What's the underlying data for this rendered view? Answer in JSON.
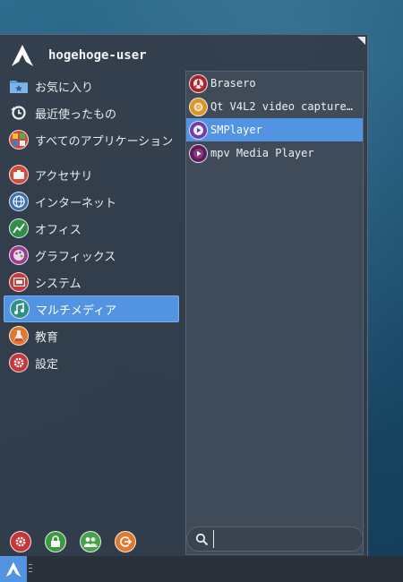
{
  "user": {
    "name": "hogehoge-user"
  },
  "categories_top": [
    {
      "label": "お気に入り",
      "icon": "favorites-folder-icon"
    },
    {
      "label": "最近使ったもの",
      "icon": "recent-history-icon"
    },
    {
      "label": "すべてのアプリケーション",
      "icon": "all-applications-icon"
    }
  ],
  "categories": [
    {
      "label": "アクセサリ",
      "icon": "accessories-icon"
    },
    {
      "label": "インターネット",
      "icon": "internet-globe-icon"
    },
    {
      "label": "オフィス",
      "icon": "office-chart-icon"
    },
    {
      "label": "グラフィックス",
      "icon": "graphics-palette-icon"
    },
    {
      "label": "システム",
      "icon": "system-icon"
    },
    {
      "label": "マルチメディア",
      "icon": "multimedia-icon",
      "active": true
    },
    {
      "label": "教育",
      "icon": "education-flask-icon"
    },
    {
      "label": "設定",
      "icon": "settings-gear-icon"
    }
  ],
  "apps": [
    {
      "label": "Brasero",
      "icon": "brasero-disc-icon"
    },
    {
      "label": "Qt V4L2 video capture…",
      "icon": "qv4l2-webcam-icon"
    },
    {
      "label": "SMPlayer",
      "icon": "smplayer-icon",
      "active": true
    },
    {
      "label": "mpv Media Player",
      "icon": "mpv-play-icon"
    }
  ],
  "bottom_actions": [
    {
      "name": "settings",
      "icon": "settings-gear-icon"
    },
    {
      "name": "lock-screen",
      "icon": "lock-icon"
    },
    {
      "name": "switch-user",
      "icon": "users-icon"
    },
    {
      "name": "log-out",
      "icon": "logout-icon"
    }
  ],
  "search": {
    "value": "",
    "placeholder": ""
  },
  "colors": {
    "accent": "#5294e2",
    "menu_bg": "#343d49",
    "icon_red": "#d44a3f",
    "icon_green": "#4bb04a",
    "icon_orange": "#e0792c",
    "icon_purple": "#9a3f8f"
  }
}
